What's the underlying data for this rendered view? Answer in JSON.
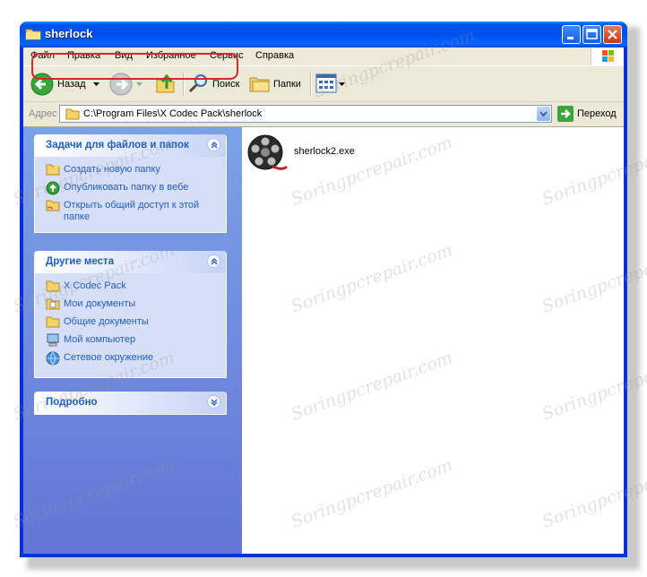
{
  "window": {
    "title": "sherlock",
    "title_icon": "folder-icon",
    "controls": {
      "minimize": "minimize-icon",
      "maximize": "maximize-icon",
      "close": "close-icon"
    }
  },
  "menu": {
    "items": [
      "Файл",
      "Правка",
      "Вид",
      "Избранное",
      "Сервис",
      "Справка"
    ]
  },
  "toolbar": {
    "back_label": "Назад",
    "search_label": "Поиск",
    "folders_label": "Папки"
  },
  "address": {
    "label": "Адрес",
    "value": "C:\\Program Files\\X Codec Pack\\sherlock",
    "go_label": "Переход"
  },
  "task_pane": {
    "file_tasks": {
      "title": "Задачи для файлов и папок",
      "items": [
        {
          "label": "Создать новую папку",
          "icon": "new-folder-icon"
        },
        {
          "label": "Опубликовать папку в вебе",
          "icon": "publish-web-icon"
        },
        {
          "label": "Открыть общий доступ к этой папке",
          "icon": "share-folder-icon"
        }
      ]
    },
    "other_places": {
      "title": "Другие места",
      "items": [
        {
          "label": "X Codec Pack",
          "icon": "folder-icon"
        },
        {
          "label": "Мои документы",
          "icon": "my-documents-icon"
        },
        {
          "label": "Общие документы",
          "icon": "shared-documents-icon"
        },
        {
          "label": "Мой компьютер",
          "icon": "my-computer-icon"
        },
        {
          "label": "Сетевое окружение",
          "icon": "network-icon"
        }
      ]
    },
    "details": {
      "title": "Подробно"
    }
  },
  "files": [
    {
      "name": "sherlock2.exe",
      "icon": "film-reel-icon"
    }
  ],
  "watermark": "Soringpcrepair.com",
  "colors": {
    "titlebar": "#0053ee",
    "link": "#215dc6",
    "highlight": "#d8262b",
    "taskpane": "#7ba2e7"
  }
}
